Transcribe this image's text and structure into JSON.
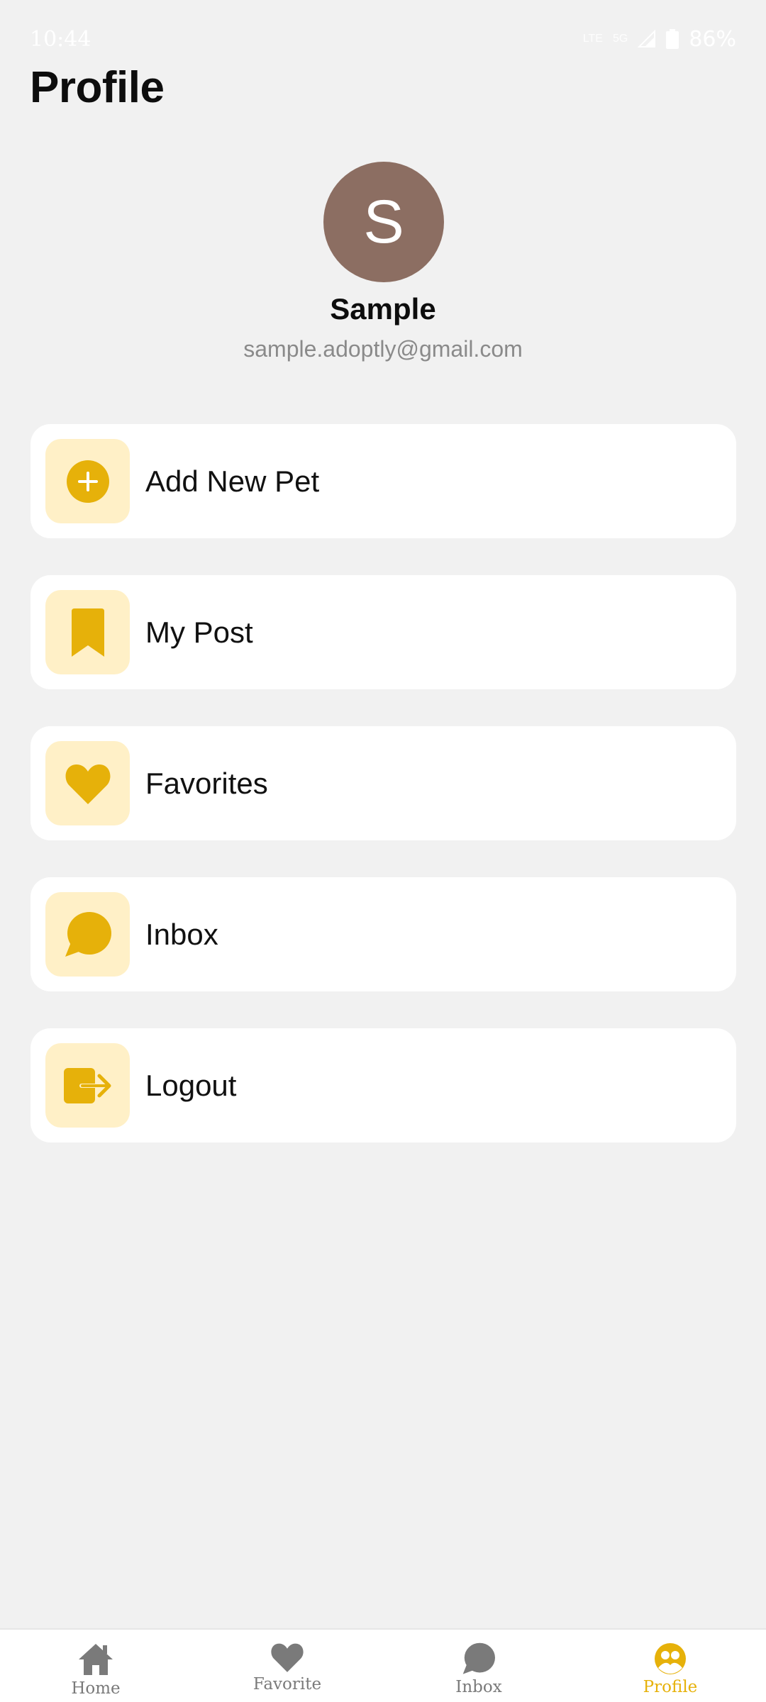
{
  "status_bar": {
    "time": "10:44",
    "network_small": "LTE",
    "network": "5G",
    "battery": "86%"
  },
  "page": {
    "title": "Profile"
  },
  "profile": {
    "avatar_initial": "S",
    "name": "Sample",
    "email": "sample.adoptly@gmail.com"
  },
  "menu": {
    "items": [
      {
        "label": "Add New Pet",
        "icon": "add-circle-icon"
      },
      {
        "label": "My Post",
        "icon": "bookmark-icon"
      },
      {
        "label": "Favorites",
        "icon": "heart-icon"
      },
      {
        "label": "Inbox",
        "icon": "chat-bubble-icon"
      },
      {
        "label": "Logout",
        "icon": "logout-icon"
      }
    ]
  },
  "bottom_nav": {
    "items": [
      {
        "label": "Home",
        "icon": "home-icon"
      },
      {
        "label": "Favorite",
        "icon": "heart-icon"
      },
      {
        "label": "Inbox",
        "icon": "chat-bubble-icon"
      },
      {
        "label": "Profile",
        "icon": "profile-icon"
      }
    ],
    "active": "Profile"
  },
  "colors": {
    "accent": "#e6b10a",
    "icon_tile_bg": "#fff0c7",
    "avatar_bg": "#8c6e62",
    "background": "#f1f1f1",
    "nav_inactive": "#7a7a7a"
  }
}
